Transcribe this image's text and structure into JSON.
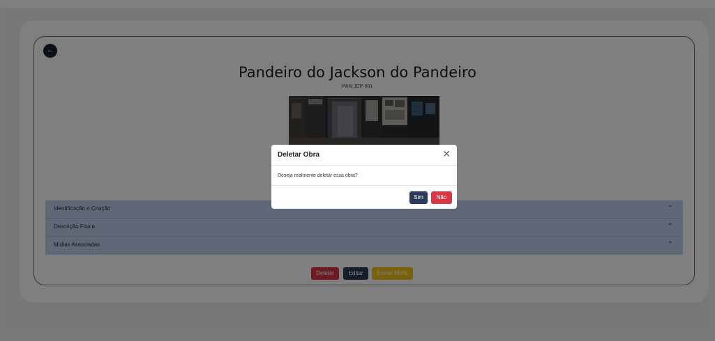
{
  "artwork": {
    "title": "Pandeiro do Jackson do Pandeiro",
    "code": "PAN-JDP-001"
  },
  "back_button": {
    "icon": "arrow-left-icon"
  },
  "accordion": {
    "items": [
      {
        "label": "Identificação e Criação"
      },
      {
        "label": "Descrição Física"
      },
      {
        "label": "Mídias Associadas"
      }
    ]
  },
  "actions": {
    "delete_label": "Deletar",
    "edit_label": "Editar",
    "send_media_label": "Enviar Mídia"
  },
  "modal": {
    "title": "Deletar Obra",
    "message": "Deseja realmente deletar essa obra?",
    "yes_label": "Sim",
    "no_label": "Não"
  },
  "colors": {
    "danger": "#dc3545",
    "primary": "#2e3a59",
    "warning": "#f5c518",
    "accordion_bg": "#bed0ec"
  }
}
